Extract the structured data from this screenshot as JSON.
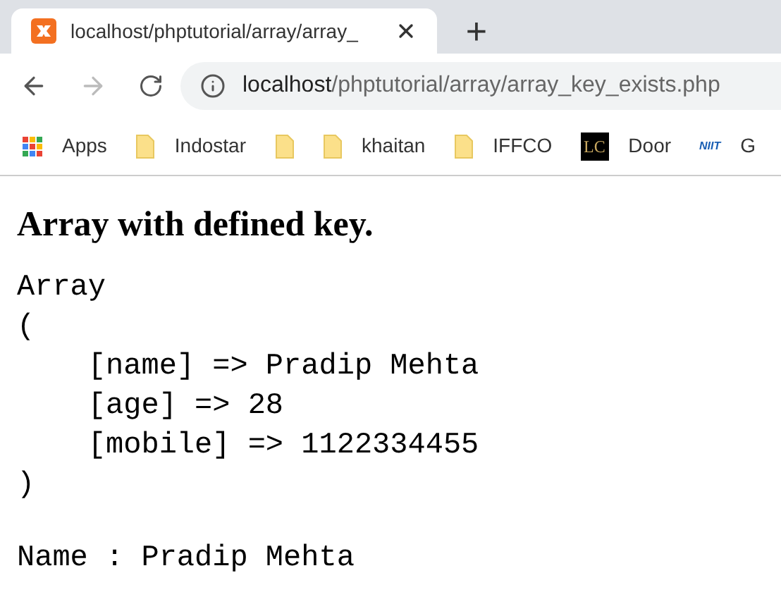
{
  "tab": {
    "title": "localhost/phptutorial/array/array_",
    "selected": true
  },
  "new_tab": "+",
  "address_bar": {
    "host": "localhost",
    "path": "/phptutorial/array/array_key_exists.php"
  },
  "bookmarks": [
    {
      "kind": "apps",
      "label": "Apps"
    },
    {
      "kind": "folder",
      "label": "Indostar"
    },
    {
      "kind": "folder"
    },
    {
      "kind": "folder",
      "label": "khaitan"
    },
    {
      "kind": "folder",
      "label": "IFFCO"
    },
    {
      "kind": "logo",
      "logo_text": "LC",
      "label": "Door"
    },
    {
      "kind": "logo2",
      "logo_text": "NIIT",
      "label": "G"
    }
  ],
  "page": {
    "heading": "Array with defined key.",
    "output_lines": [
      "Array",
      "(",
      "    [name] => Pradip Mehta",
      "    [age] => 28",
      "    [mobile] => 1122334455",
      ")"
    ],
    "name_line": "Name : Pradip Mehta"
  }
}
